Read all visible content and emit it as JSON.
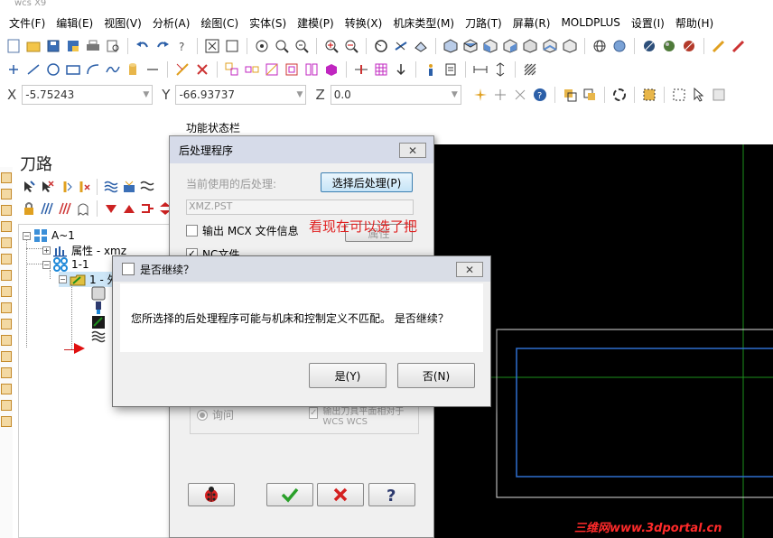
{
  "app": {
    "title": "wcs X9"
  },
  "menu": [
    "文件(F)",
    "编辑(E)",
    "视图(V)",
    "分析(A)",
    "绘图(C)",
    "实体(S)",
    "建模(P)",
    "转换(X)",
    "机床类型(M)",
    "刀路(T)",
    "屏幕(R)",
    "MOLDPLUS",
    "设置(I)",
    "帮助(H)"
  ],
  "coords": {
    "x_label": "X",
    "x_value": "-5.75243",
    "y_label": "Y",
    "y_value": "-66.93737",
    "z_label": "Z",
    "z_value": "0.0"
  },
  "status_label": "功能状态栏",
  "toolpath_panel": {
    "title": "刀路",
    "tree": {
      "root": "A~1",
      "properties": "属性 - xmz",
      "group": "1-1",
      "operation": "1 - 外"
    }
  },
  "post_dialog": {
    "title": "后处理程序",
    "current_post_label": "当前使用的后处理:",
    "select_button": "选择后处理(P)",
    "current_post_value": "XMZ.PST",
    "output_mcx_label": "输出 MCX 文件信息",
    "properties_button": "属性",
    "nc_file_label": "NC文件",
    "ask_label": "询问",
    "output_tool_plane_label": "输出刀具平面相对于 WCS WCS",
    "colors": {
      "ok": "#2aa02a",
      "cancel": "#d42020"
    }
  },
  "confirm_dialog": {
    "title": "是否继续？",
    "message": "您所选择的后处理程序可能与机床和控制定义不匹配。 是否继续？",
    "yes_button": "是(Y)",
    "no_button": "否(N)"
  },
  "annotation": "看现在可以选了把",
  "watermark": "三维网www.3dportal.cn"
}
